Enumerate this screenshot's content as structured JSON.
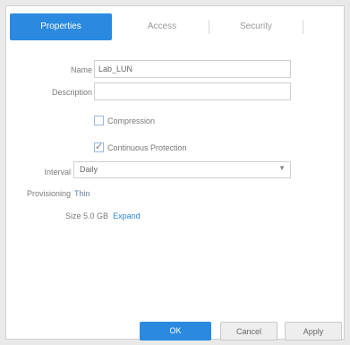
{
  "tabs": [
    {
      "label": "Properties"
    },
    {
      "label": "Access"
    },
    {
      "label": "Security"
    }
  ],
  "form": {
    "name_label": "Name",
    "name_value": "Lab_LUN",
    "description_label": "Description",
    "description_value": "",
    "compression_label": "Compression",
    "compression_checked": false,
    "continuous_protection_label": "Continuous Protection",
    "continuous_protection_checked": true,
    "interval_label": "Interval",
    "interval_value": "Daily",
    "provisioning_label": "Provisioning",
    "provisioning_value": "Thin",
    "size_label": "Size",
    "size_value": "5.0 GB",
    "expand_link": "Expand"
  },
  "buttons": {
    "ok": "OK",
    "cancel": "Cancel",
    "apply": "Apply"
  },
  "colors": {
    "accent": "#2b8ae0"
  }
}
